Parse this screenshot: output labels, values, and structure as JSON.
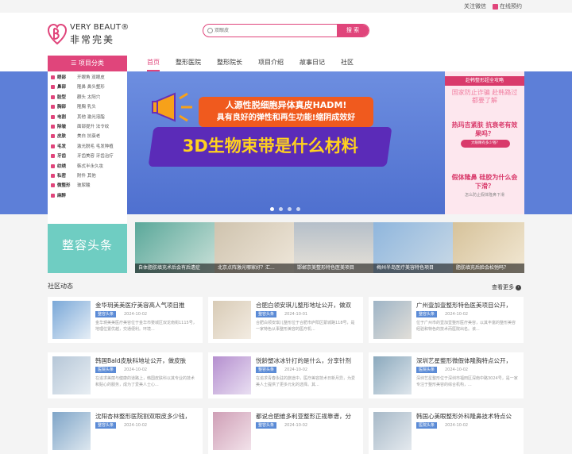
{
  "topbar": {
    "follow": "关注微信",
    "booking": "在线预约"
  },
  "logo": {
    "en": "VERY BEAUT®",
    "cn": "非常完美"
  },
  "search": {
    "placeholder": "双眼皮",
    "button": "搜 索"
  },
  "nav": {
    "category": "☰ 项目分类",
    "items": [
      "首页",
      "整形医院",
      "整形院长",
      "项目介绍",
      "故事日记",
      "社区"
    ]
  },
  "sidebar": [
    {
      "cat": "眼部",
      "subs": "开眼角 双眼皮"
    },
    {
      "cat": "鼻部",
      "subs": "隆鼻 鼻头整形"
    },
    {
      "cat": "脸型",
      "subs": "颧头 太阳穴"
    },
    {
      "cat": "胸部",
      "subs": "隆胸 乳头"
    },
    {
      "cat": "电割",
      "subs": "其他 激光溶脂"
    },
    {
      "cat": "除皱",
      "subs": "面部提升 法令纹"
    },
    {
      "cat": "皮肤",
      "subs": "美白 抗衰老"
    },
    {
      "cat": "毛发",
      "subs": "激光脱毛 毛发种植"
    },
    {
      "cat": "牙齿",
      "subs": "牙齿美容 牙齿治疗"
    },
    {
      "cat": "纹绣",
      "subs": "韩式半永久妆"
    },
    {
      "cat": "私密",
      "subs": "附件 其他"
    },
    {
      "cat": "微整形",
      "subs": "玻尿酸"
    },
    {
      "cat": "麻醉",
      "subs": ""
    }
  ],
  "banner": {
    "line1": "人源性脱细胞异体真皮HADM!",
    "line2": "具有良好的弹性和再生功能!缩阴成效好",
    "headline": "3D生物束带是什么材料"
  },
  "right_promo": {
    "header": "赴韩整形超全攻略",
    "t1": "国家防止诈骗 赴韩路过 都要了解",
    "q1": "热玛吉紧肤 抗衰老有效果吗？",
    "q1_btn": "大眼睛有多少钱？",
    "q2": "假体隆鼻 硅胶为什么会下滑？",
    "q2_sub": "怎么防止假体隆鼻下滑"
  },
  "thumbs": [
    {
      "caption": "整容头条"
    },
    {
      "caption": "自体脂肪填充术后会有后遗症"
    },
    {
      "caption": "北京点阵激光哪家好？汇..."
    },
    {
      "caption": "邯郸京美整形特色医美项目"
    },
    {
      "caption": "梅州半岛医疗美容特色项目"
    },
    {
      "caption": "脂肪填充后脸会松弛吗？"
    }
  ],
  "section": {
    "title": "社区动态",
    "more": "查看更多"
  },
  "cards": [
    {
      "title": "金华玥美美医疗美容高人气项目推",
      "tag": "整容头条",
      "date": "2024-10-02",
      "desc": "金华玥美美医疗美容位于金华市婺城区双龙南街1115号，地理位置优越，交通便利。环境..."
    },
    {
      "title": "合肥白领安琪儿整形地址公开，做双",
      "tag": "整容头条",
      "date": "2024-10-01",
      "desc": "合肥白领安琪儿整形位于合肥市庐阳区蒙城路118号，是一家特色从事整形美容的医疗机..."
    },
    {
      "title": "广州壹加壹整形特色医美项目公开，",
      "tag": "整容头条",
      "date": "2024-10-02",
      "desc": "位于广州市的壹加壹整形医疗美容，以其丰富的整形美容经验和特色的技术而医院出名。该..."
    },
    {
      "title": "韩国Bald皮肤科地址公开，做皮肤",
      "tag": "医院头条",
      "date": "2024-10-02",
      "desc": "在追求美丽与健康的道路上，韩国皮肤科以其专业的技术和贴心的服务，成为了爱美人士心..."
    },
    {
      "title": "悦龄塑冰冰针打的是什么，分享针剂",
      "tag": "整容头条",
      "date": "2024-10-02",
      "desc": "在追求青春永驻的旅途中，医疗美容技术日新月异，为爱美人士提供了更多元化的选择。其..."
    },
    {
      "title": "深圳艺星整形微假体隆胸特点公开，",
      "tag": "医院头条",
      "date": "2024-10-02",
      "desc": "深圳艺星整形位于深圳市福田区深南中路3024号，是一家专注于整形美容的综合机构，..."
    },
    {
      "title": "沈阳杏林整形医院割双眼皮多少钱，",
      "tag": "整容头条",
      "date": "2024-10-02",
      "desc": ""
    },
    {
      "title": "都说合肥维多利亚整形正规靠谱，分",
      "tag": "整容头条",
      "date": "2024-10-02",
      "desc": ""
    },
    {
      "title": "韩国心美眼整形外科隆鼻技术特点公",
      "tag": "医院头条",
      "date": "2024-10-02",
      "desc": ""
    }
  ],
  "colors": {
    "accent": "#e0457b",
    "tag_blue": "#5b8bd6",
    "banner_blue": "#5d7fd8"
  }
}
